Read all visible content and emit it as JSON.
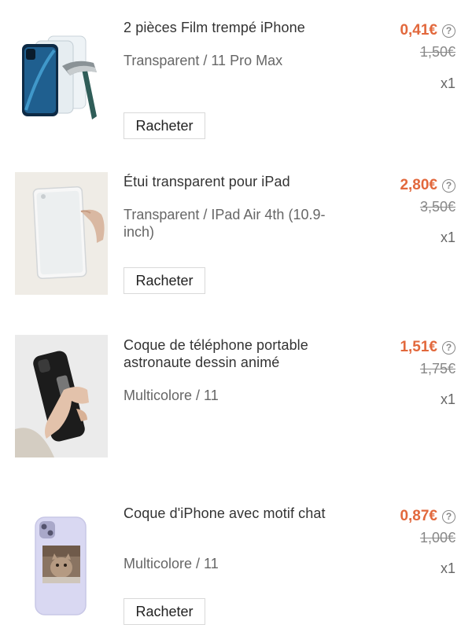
{
  "items": [
    {
      "title": "2 pièces Film trempé iPhone",
      "variant": "Transparent / 11 Pro Max",
      "price": "0,41€",
      "original_price": "1,50€",
      "quantity": "x1",
      "button": "Racheter",
      "thumbnail_icon": "tempered-glass-hammer-image"
    },
    {
      "title": "Étui transparent pour iPad",
      "variant": "Transparent / IPad Air 4th (10.9-inch)",
      "price": "2,80€",
      "original_price": "3,50€",
      "quantity": "x1",
      "button": "Racheter",
      "thumbnail_icon": "clear-ipad-case-image"
    },
    {
      "title": "Coque de téléphone portable astronaute dessin animé",
      "variant": "Multicolore / 11",
      "price": "1,51€",
      "original_price": "1,75€",
      "quantity": "x1",
      "thumbnail_icon": "black-phone-case-in-hand-image"
    },
    {
      "title": "Coque d'iPhone avec motif chat",
      "variant": "Multicolore / 11",
      "price": "0,87€",
      "original_price": "1,00€",
      "quantity": "x1",
      "button": "Racheter",
      "thumbnail_icon": "cat-pattern-phone-case-image"
    }
  ],
  "help_glyph": "?",
  "colors": {
    "price": "#e2683c",
    "muted": "#888888"
  }
}
